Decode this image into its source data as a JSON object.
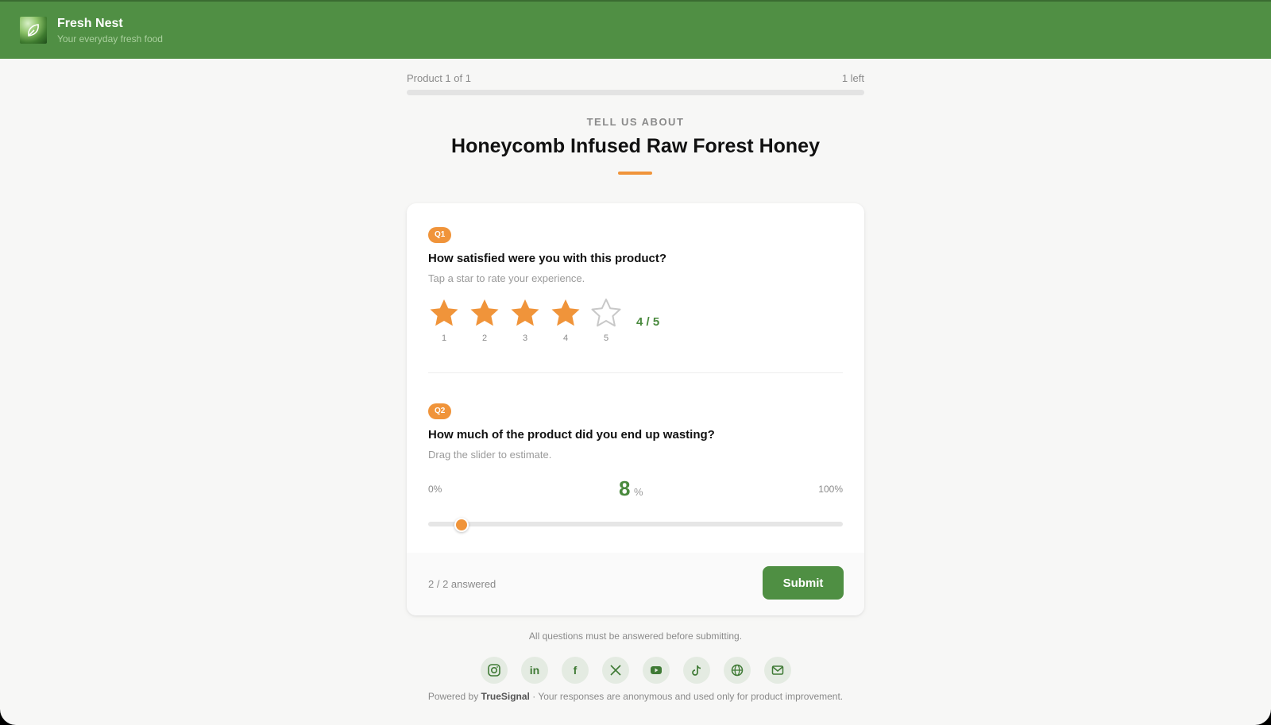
{
  "brand": {
    "name": "Fresh Nest",
    "tagline": "Your everyday fresh food"
  },
  "progress": {
    "left_label": "Product 1 of 1",
    "right_label": "1 left"
  },
  "header": {
    "kicker": "TELL US ABOUT",
    "product_name": "Honeycomb Infused Raw Forest Honey"
  },
  "q1": {
    "badge": "Q1",
    "question": "How satisfied were you with this product?",
    "hint": "Tap a star to rate your experience.",
    "rating": 4,
    "max": 5,
    "star_labels": [
      "1",
      "2",
      "3",
      "4",
      "5"
    ],
    "readout": "4 / 5"
  },
  "q2": {
    "badge": "Q2",
    "question": "How much of the product did you end up wasting?",
    "hint": "Drag the slider to estimate.",
    "min_label": "0%",
    "max_label": "100%",
    "value": 8,
    "value_text": "8",
    "unit": "%"
  },
  "footer": {
    "answered": "2 / 2 answered",
    "submit_label": "Submit"
  },
  "note": "All questions must be answered before submitting.",
  "social_icons": [
    "instagram-icon",
    "linkedin-icon",
    "facebook-icon",
    "x-icon",
    "youtube-icon",
    "tiktok-icon",
    "globe-icon",
    "mail-icon"
  ],
  "powered": {
    "prefix": "Powered by ",
    "brand": "TrueSignal",
    "suffix": " · Your responses are anonymous and used only for product improvement."
  },
  "colors": {
    "brand_green": "#508f44",
    "accent_orange": "#f0943a",
    "star_empty": "#c8c8c8"
  }
}
